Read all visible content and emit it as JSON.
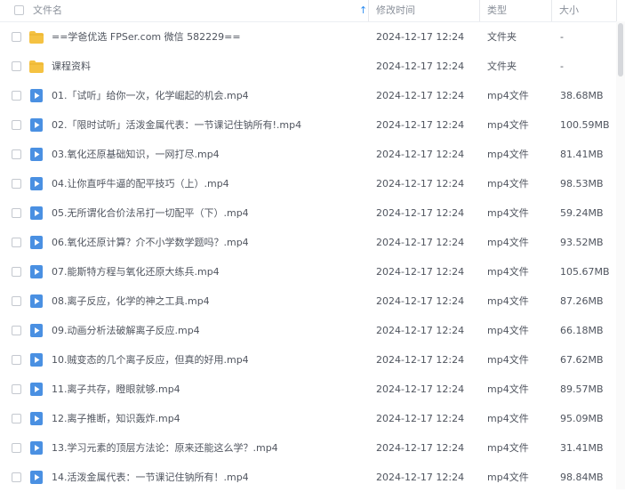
{
  "header": {
    "name_label": "文件名",
    "sort_icon": "arrow-up-icon",
    "time_label": "修改时间",
    "type_label": "类型",
    "size_label": "大小"
  },
  "files": [
    {
      "name": "==学爸优选 FPSer.com 微信 582229==",
      "time": "2024-12-17 12:24",
      "type": "文件夹",
      "size": "-",
      "icon": "folder-icon"
    },
    {
      "name": "课程资料",
      "time": "2024-12-17 12:24",
      "type": "文件夹",
      "size": "-",
      "icon": "folder-icon"
    },
    {
      "name": "01.「试听」给你一次，化学崛起的机会.mp4",
      "time": "2024-12-17 12:24",
      "type": "mp4文件",
      "size": "38.68MB",
      "icon": "video-file-icon"
    },
    {
      "name": "02.「限时试听」活泼金属代表：一节课记住钠所有!.mp4",
      "time": "2024-12-17 12:24",
      "type": "mp4文件",
      "size": "100.59MB",
      "icon": "video-file-icon"
    },
    {
      "name": "03.氧化还原基础知识，一网打尽.mp4",
      "time": "2024-12-17 12:24",
      "type": "mp4文件",
      "size": "81.41MB",
      "icon": "video-file-icon"
    },
    {
      "name": "04.让你直呼牛逼的配平技巧（上）.mp4",
      "time": "2024-12-17 12:24",
      "type": "mp4文件",
      "size": "98.53MB",
      "icon": "video-file-icon"
    },
    {
      "name": "05.无所谓化合价法吊打一切配平（下）.mp4",
      "time": "2024-12-17 12:24",
      "type": "mp4文件",
      "size": "59.24MB",
      "icon": "video-file-icon"
    },
    {
      "name": "06.氧化还原计算？介不小学数学题吗？.mp4",
      "time": "2024-12-17 12:24",
      "type": "mp4文件",
      "size": "93.52MB",
      "icon": "video-file-icon"
    },
    {
      "name": "07.能斯特方程与氧化还原大练兵.mp4",
      "time": "2024-12-17 12:24",
      "type": "mp4文件",
      "size": "105.67MB",
      "icon": "video-file-icon"
    },
    {
      "name": "08.离子反应，化学的神之工具.mp4",
      "time": "2024-12-17 12:24",
      "type": "mp4文件",
      "size": "87.26MB",
      "icon": "video-file-icon"
    },
    {
      "name": "09.动画分析法破解离子反应.mp4",
      "time": "2024-12-17 12:24",
      "type": "mp4文件",
      "size": "66.18MB",
      "icon": "video-file-icon"
    },
    {
      "name": "10.贼变态的几个离子反应，但真的好用.mp4",
      "time": "2024-12-17 12:24",
      "type": "mp4文件",
      "size": "67.62MB",
      "icon": "video-file-icon"
    },
    {
      "name": "11.离子共存，瞪眼就够.mp4",
      "time": "2024-12-17 12:24",
      "type": "mp4文件",
      "size": "89.57MB",
      "icon": "video-file-icon"
    },
    {
      "name": "12.离子推断，知识轰炸.mp4",
      "time": "2024-12-17 12:24",
      "type": "mp4文件",
      "size": "95.09MB",
      "icon": "video-file-icon"
    },
    {
      "name": "13.学习元素的顶层方法论：原来还能这么学？.mp4",
      "time": "2024-12-17 12:24",
      "type": "mp4文件",
      "size": "31.41MB",
      "icon": "video-file-icon"
    },
    {
      "name": "14.活泼金属代表：一节课记住钠所有！.mp4",
      "time": "2024-12-17 12:24",
      "type": "mp4文件",
      "size": "98.84MB",
      "icon": "video-file-icon"
    }
  ],
  "colors": {
    "folder": "#f5c242",
    "video": "#4a90e2"
  }
}
